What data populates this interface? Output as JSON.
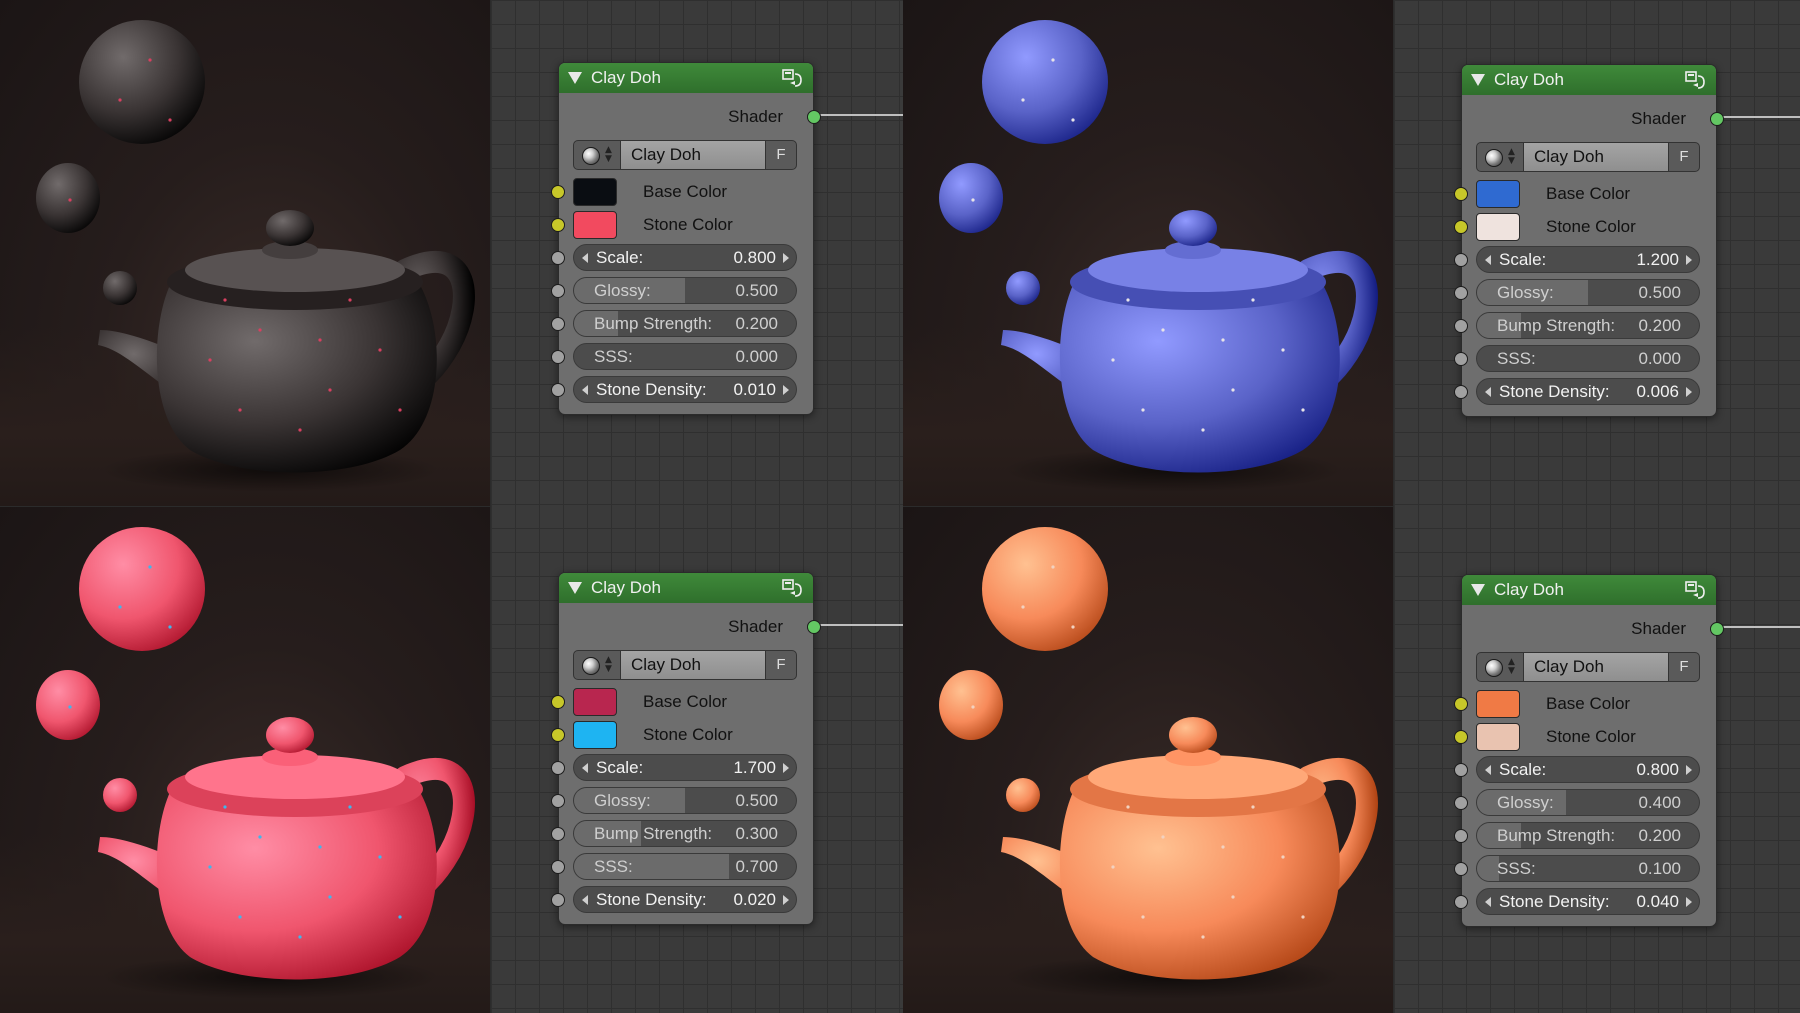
{
  "nodes": [
    {
      "title": "Clay Doh",
      "output_label": "Shader",
      "group_name": "Clay Doh",
      "fake_user_label": "F",
      "base_color_label": "Base Color",
      "stone_color_label": "Stone Color",
      "base_color": "#0a0d12",
      "stone_color": "#f24a5f",
      "scale_label": "Scale:",
      "scale_value": "0.800",
      "glossy_label": "Glossy:",
      "glossy_value": "0.500",
      "glossy_fraction": 0.5,
      "bump_label": "Bump Strength:",
      "bump_value": "0.200",
      "bump_fraction": 0.2,
      "sss_label": "SSS:",
      "sss_value": "0.000",
      "sss_fraction": 0.0,
      "density_label": "Stone Density:",
      "density_value": "0.010"
    },
    {
      "title": "Clay Doh",
      "output_label": "Shader",
      "group_name": "Clay Doh",
      "fake_user_label": "F",
      "base_color_label": "Base Color",
      "stone_color_label": "Stone Color",
      "base_color": "#2f6ad1",
      "stone_color": "#efe3de",
      "scale_label": "Scale:",
      "scale_value": "1.200",
      "glossy_label": "Glossy:",
      "glossy_value": "0.500",
      "glossy_fraction": 0.5,
      "bump_label": "Bump Strength:",
      "bump_value": "0.200",
      "bump_fraction": 0.2,
      "sss_label": "SSS:",
      "sss_value": "0.000",
      "sss_fraction": 0.0,
      "density_label": "Stone Density:",
      "density_value": "0.006"
    },
    {
      "title": "Clay Doh",
      "output_label": "Shader",
      "group_name": "Clay Doh",
      "fake_user_label": "F",
      "base_color_label": "Base Color",
      "stone_color_label": "Stone Color",
      "base_color": "#b8264f",
      "stone_color": "#1eb4f2",
      "scale_label": "Scale:",
      "scale_value": "1.700",
      "glossy_label": "Glossy:",
      "glossy_value": "0.500",
      "glossy_fraction": 0.5,
      "bump_label": "Bump Strength:",
      "bump_value": "0.300",
      "bump_fraction": 0.3,
      "sss_label": "SSS:",
      "sss_value": "0.700",
      "sss_fraction": 0.7,
      "density_label": "Stone Density:",
      "density_value": "0.020"
    },
    {
      "title": "Clay Doh",
      "output_label": "Shader",
      "group_name": "Clay Doh",
      "fake_user_label": "F",
      "base_color_label": "Base Color",
      "stone_color_label": "Stone Color",
      "base_color": "#f07a45",
      "stone_color": "#e9c3b0",
      "scale_label": "Scale:",
      "scale_value": "0.800",
      "glossy_label": "Glossy:",
      "glossy_value": "0.400",
      "glossy_fraction": 0.4,
      "bump_label": "Bump Strength:",
      "bump_value": "0.200",
      "bump_fraction": 0.2,
      "sss_label": "SSS:",
      "sss_value": "0.100",
      "sss_fraction": 0.1,
      "density_label": "Stone Density:",
      "density_value": "0.040"
    }
  ],
  "renders": [
    {
      "clay_color": "#3a3434",
      "speck_color": "#d84060"
    },
    {
      "clay_color": "#5a63c8",
      "speck_color": "#e8e4e8"
    },
    {
      "clay_color": "#f0566e",
      "speck_color": "#3cb8ee"
    },
    {
      "clay_color": "#f78a5a",
      "speck_color": "#f2d2c0"
    }
  ]
}
